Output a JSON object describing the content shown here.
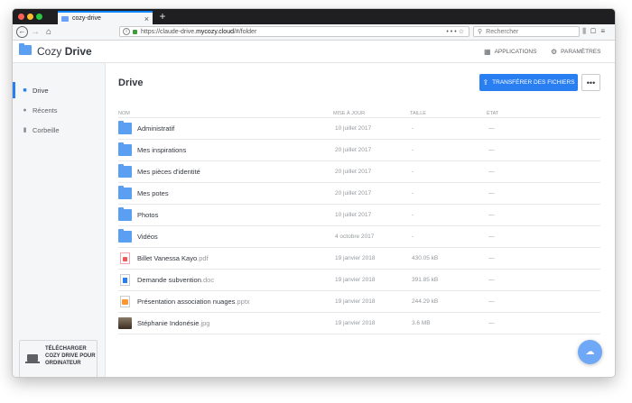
{
  "browser": {
    "tab_title": "cozy-drive",
    "url_prefix": "https://claude-drive.",
    "url_domain": "mycozy.cloud",
    "url_suffix": "/#/folder",
    "url_actions": "•••",
    "search_placeholder": "Rechercher"
  },
  "app": {
    "brand_light": "Cozy",
    "brand_bold": "Drive",
    "applications_label": "APPLICATIONS",
    "settings_label": "PARAMÈTRES"
  },
  "sidebar": {
    "items": [
      {
        "label": "Drive",
        "active": true
      },
      {
        "label": "Récents",
        "active": false
      },
      {
        "label": "Corbeille",
        "active": false
      }
    ],
    "download_label": "TÉLÉCHARGER COZY DRIVE POUR ORDINATEUR"
  },
  "main": {
    "title": "Drive",
    "upload_label": "TRANSFÉRER DES FICHIERS",
    "more_label": "•••",
    "columns": {
      "name": "NOM",
      "modified": "MISE À JOUR",
      "size": "TAILLE",
      "state": "ÉTAT"
    },
    "rows": [
      {
        "type": "folder",
        "name": "Administratif",
        "ext": "",
        "date": "10 juillet 2017",
        "size": "-",
        "state": "—"
      },
      {
        "type": "folder",
        "name": "Mes inspirations",
        "ext": "",
        "date": "20 juillet 2017",
        "size": "-",
        "state": "—"
      },
      {
        "type": "folder",
        "name": "Mes pièces d'identité",
        "ext": "",
        "date": "20 juillet 2017",
        "size": "-",
        "state": "—"
      },
      {
        "type": "folder",
        "name": "Mes potes",
        "ext": "",
        "date": "20 juillet 2017",
        "size": "-",
        "state": "—"
      },
      {
        "type": "folder",
        "name": "Photos",
        "ext": "",
        "date": "10 juillet 2017",
        "size": "-",
        "state": "—"
      },
      {
        "type": "folder",
        "name": "Vidéos",
        "ext": "",
        "date": "4 octobre 2017",
        "size": "-",
        "state": "—"
      },
      {
        "type": "pdf",
        "name": "Billet Vanessa Kayo",
        "ext": ".pdf",
        "date": "19 janvier 2018",
        "size": "430.05 kB",
        "state": "—"
      },
      {
        "type": "doc",
        "name": "Demande subvention",
        "ext": ".doc",
        "date": "19 janvier 2018",
        "size": "391.85 kB",
        "state": "—"
      },
      {
        "type": "pptx",
        "name": "Présentation association nuages",
        "ext": ".pptx",
        "date": "19 janvier 2018",
        "size": "244.29 kB",
        "state": "—"
      },
      {
        "type": "image",
        "name": "Stéphanie Indonésie",
        "ext": ".jpg",
        "date": "19 janvier 2018",
        "size": "3.6 MB",
        "state": "—"
      }
    ]
  }
}
